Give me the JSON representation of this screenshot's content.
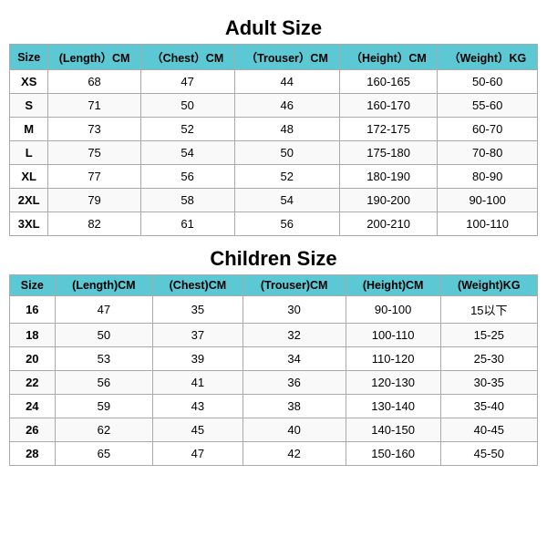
{
  "adult": {
    "title": "Adult Size",
    "headers": [
      "Size",
      "(Length）CM",
      "（Chest）CM",
      "（Trouser）CM",
      "（Height）CM",
      "（Weight）KG"
    ],
    "rows": [
      [
        "XS",
        "68",
        "47",
        "44",
        "160-165",
        "50-60"
      ],
      [
        "S",
        "71",
        "50",
        "46",
        "160-170",
        "55-60"
      ],
      [
        "M",
        "73",
        "52",
        "48",
        "172-175",
        "60-70"
      ],
      [
        "L",
        "75",
        "54",
        "50",
        "175-180",
        "70-80"
      ],
      [
        "XL",
        "77",
        "56",
        "52",
        "180-190",
        "80-90"
      ],
      [
        "2XL",
        "79",
        "58",
        "54",
        "190-200",
        "90-100"
      ],
      [
        "3XL",
        "82",
        "61",
        "56",
        "200-210",
        "100-110"
      ]
    ]
  },
  "children": {
    "title": "Children Size",
    "headers": [
      "Size",
      "(Length)CM",
      "(Chest)CM",
      "(Trouser)CM",
      "(Height)CM",
      "(Weight)KG"
    ],
    "rows": [
      [
        "16",
        "47",
        "35",
        "30",
        "90-100",
        "15以下"
      ],
      [
        "18",
        "50",
        "37",
        "32",
        "100-110",
        "15-25"
      ],
      [
        "20",
        "53",
        "39",
        "34",
        "110-120",
        "25-30"
      ],
      [
        "22",
        "56",
        "41",
        "36",
        "120-130",
        "30-35"
      ],
      [
        "24",
        "59",
        "43",
        "38",
        "130-140",
        "35-40"
      ],
      [
        "26",
        "62",
        "45",
        "40",
        "140-150",
        "40-45"
      ],
      [
        "28",
        "65",
        "47",
        "42",
        "150-160",
        "45-50"
      ]
    ]
  }
}
